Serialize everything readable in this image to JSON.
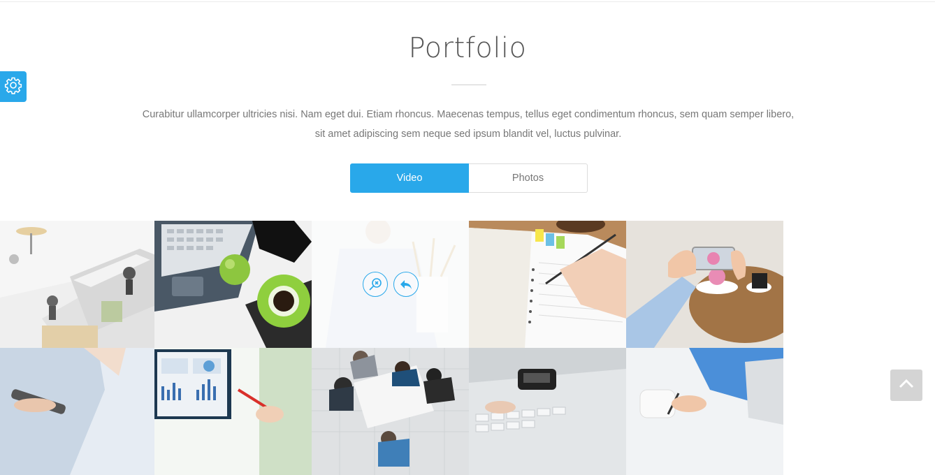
{
  "section": {
    "title": "Portfolio",
    "intro_line1": "Curabitur ullamcorper ultricies nisi. Nam eget dui. Etiam rhoncus. Maecenas tempus, tellus eget condimentum rhoncus, sem quam semper libero,",
    "intro_line2": "sit amet adipiscing sem neque sed ipsum blandit vel, luctus pulvinar."
  },
  "filters": [
    {
      "label": "Video",
      "active": true
    },
    {
      "label": "Photos",
      "active": false
    }
  ],
  "colors": {
    "accent": "#29a8ea",
    "text": "#777777",
    "title": "#555555",
    "scroll_top_bg": "#d4d4d4"
  },
  "icons": {
    "settings": "gear-icon",
    "zoom": "magnifier-icon",
    "link": "reply-arrow-icon",
    "scroll_top": "chevron-up-icon"
  },
  "portfolio_items": [
    "office-desk-photo",
    "laptop-apple-coffee-photo",
    "person-pencil-cup-photo-hovered",
    "notebook-writing-photo",
    "phone-cupcake-photo",
    "tablet-hands-photo",
    "monitor-charts-photo",
    "meeting-table-photo",
    "keyboard-phone-photo",
    "business-writing-photo"
  ]
}
